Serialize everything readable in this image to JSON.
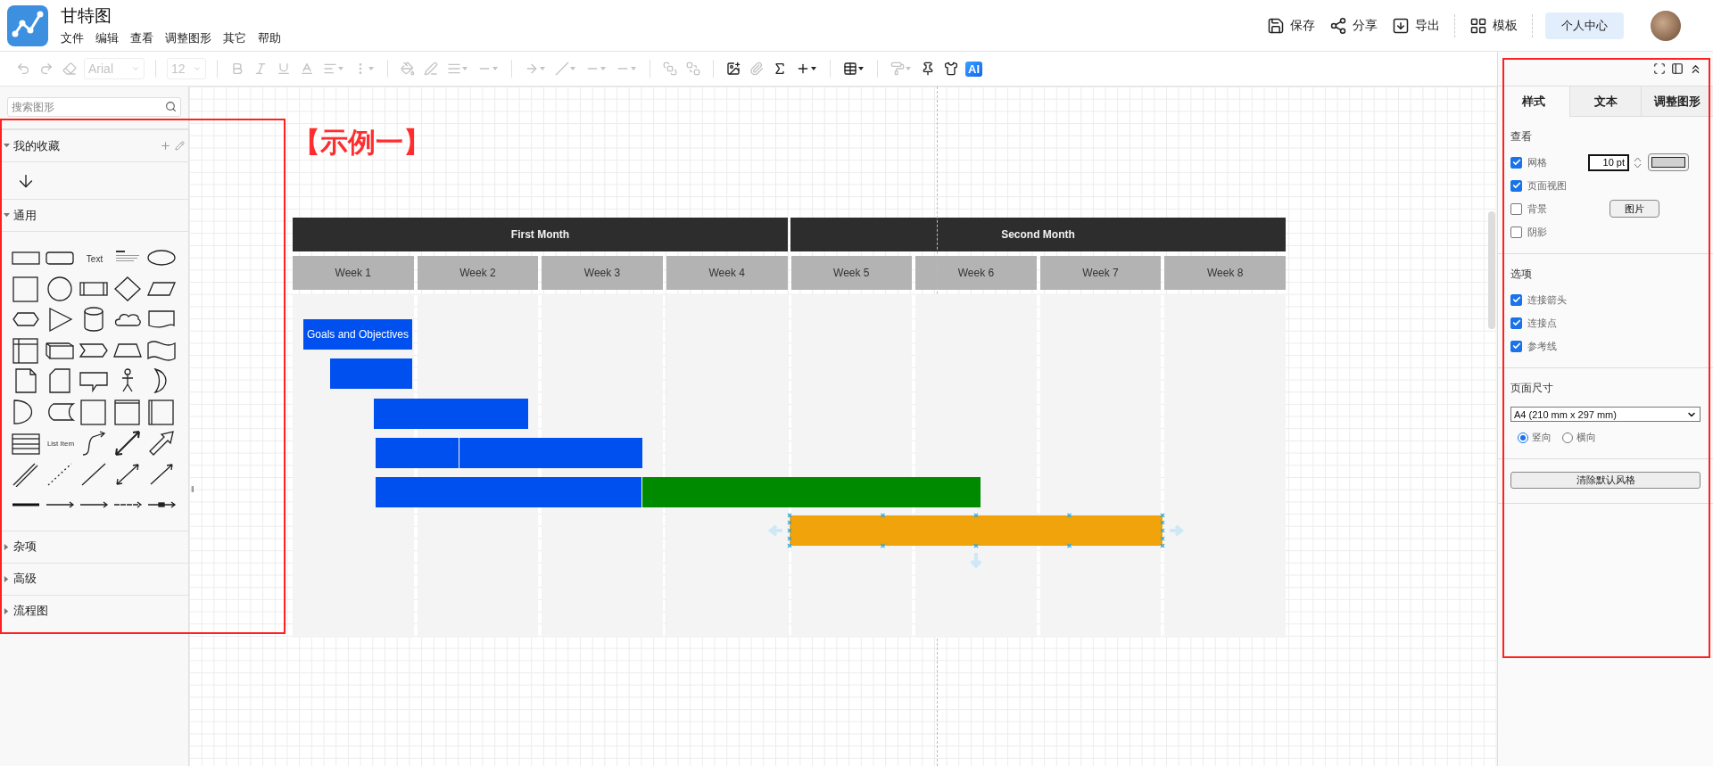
{
  "app": {
    "title": "甘特图",
    "menu": [
      "文件",
      "编辑",
      "查看",
      "调整图形",
      "其它",
      "帮助"
    ]
  },
  "actions": [
    {
      "label": "保存"
    },
    {
      "label": "分享"
    },
    {
      "label": "导出"
    },
    {
      "label": "模板"
    }
  ],
  "account_button": "个人中心",
  "toolbar": [
    {
      "kind": "icon",
      "disabled": true
    },
    {
      "kind": "icon",
      "disabled": true
    },
    {
      "kind": "icon",
      "disabled": true
    },
    {
      "kind": "select",
      "label": "Arial",
      "disabled": true
    },
    {
      "kind": "sep"
    },
    {
      "kind": "select",
      "label": "12",
      "disabled": true
    },
    {
      "kind": "sep"
    },
    {
      "kind": "icon",
      "disabled": true
    },
    {
      "kind": "icon",
      "disabled": true
    },
    {
      "kind": "icon",
      "disabled": true
    },
    {
      "kind": "icon",
      "disabled": true
    },
    {
      "kind": "menu",
      "disabled": true
    },
    {
      "kind": "menu",
      "disabled": true
    },
    {
      "kind": "sep"
    },
    {
      "kind": "icon",
      "disabled": true
    },
    {
      "kind": "icon",
      "disabled": true
    },
    {
      "kind": "menu",
      "disabled": true
    },
    {
      "kind": "menu",
      "disabled": true
    },
    {
      "kind": "sep"
    },
    {
      "kind": "menu",
      "disabled": true
    },
    {
      "kind": "menu",
      "disabled": true
    },
    {
      "kind": "menu",
      "disabled": true
    },
    {
      "kind": "menu",
      "disabled": true
    },
    {
      "kind": "sep"
    },
    {
      "kind": "icon",
      "disabled": true
    },
    {
      "kind": "icon",
      "disabled": true
    },
    {
      "kind": "sep"
    },
    {
      "kind": "icon",
      "disabled": false
    },
    {
      "kind": "icon",
      "disabled": true
    },
    {
      "kind": "icon",
      "disabled": false
    },
    {
      "kind": "menu",
      "disabled": false
    },
    {
      "kind": "sep"
    },
    {
      "kind": "menu",
      "disabled": false
    },
    {
      "kind": "sep"
    },
    {
      "kind": "menu",
      "disabled": true
    },
    {
      "kind": "icon",
      "disabled": false
    },
    {
      "kind": "icon",
      "disabled": false
    },
    {
      "kind": "badge",
      "label": "AI",
      "disabled": false
    }
  ],
  "sidebar": {
    "search": {
      "placeholder": "搜索图形"
    },
    "sections": [
      {
        "title": "我的收藏",
        "expanded": true,
        "kind": "favorites"
      },
      {
        "title": "通用",
        "expanded": true,
        "kind": "shapes"
      },
      {
        "title": "杂项",
        "expanded": false,
        "kind": "shapes"
      },
      {
        "title": "高级",
        "expanded": false,
        "kind": "shapes"
      },
      {
        "title": "流程图",
        "expanded": false,
        "kind": "shapes"
      }
    ],
    "shape_labels": [
      "Text",
      "List Item"
    ]
  },
  "splitter_handle": "‖",
  "gantt": {
    "title": "【示例一】",
    "months": [
      "First Month",
      "Second Month"
    ],
    "weeks": [
      "Week 1",
      "Week 2",
      "Week 3",
      "Week 4",
      "Week 5",
      "Week 6",
      "Week 7",
      "Week 8"
    ],
    "tasks": [
      {
        "selected": false,
        "segments": [
          {
            "label": "Goals and Objectives",
            "color": "#0050ef"
          }
        ]
      },
      {
        "selected": false,
        "segments": [
          {
            "color": "#0050ef"
          }
        ]
      },
      {
        "selected": false,
        "segments": [
          {
            "color": "#0050ef"
          }
        ]
      },
      {
        "selected": false,
        "segments": [
          {
            "color": "#0050ef"
          },
          {
            "color": "#0050ef"
          }
        ]
      },
      {
        "selected": false,
        "segments": [
          {
            "color": "#0050ef"
          },
          {
            "color": "#008a00"
          }
        ]
      },
      {
        "selected": true,
        "segments": [
          {
            "color": "#f0a30a"
          }
        ]
      }
    ]
  },
  "format_panel": {
    "tabs": [
      {
        "label": "样式",
        "selected": true
      },
      {
        "label": "文本",
        "selected": false
      },
      {
        "label": "调整图形",
        "selected": false
      }
    ],
    "view": {
      "title": "查看",
      "options": [
        {
          "kind": "grid",
          "label": "网格",
          "checked": true,
          "value": "10 pt"
        },
        {
          "kind": "plain",
          "label": "页面视图",
          "checked": true
        },
        {
          "kind": "image",
          "label": "背景",
          "checked": false,
          "button": "图片"
        },
        {
          "kind": "plain",
          "label": "阴影",
          "checked": false
        }
      ]
    },
    "options": {
      "title": "选项",
      "options": [
        {
          "kind": "plain",
          "label": "连接箭头",
          "checked": true
        },
        {
          "kind": "plain",
          "label": "连接点",
          "checked": true
        },
        {
          "kind": "plain",
          "label": "参考线",
          "checked": true
        }
      ]
    },
    "page_size": {
      "title": "页面尺寸",
      "value": "A4 (210 mm x 297 mm)",
      "orientations": [
        {
          "label": "竖向",
          "selected": true
        },
        {
          "label": "横向",
          "selected": false
        }
      ]
    },
    "reset_button": "清除默认风格"
  }
}
